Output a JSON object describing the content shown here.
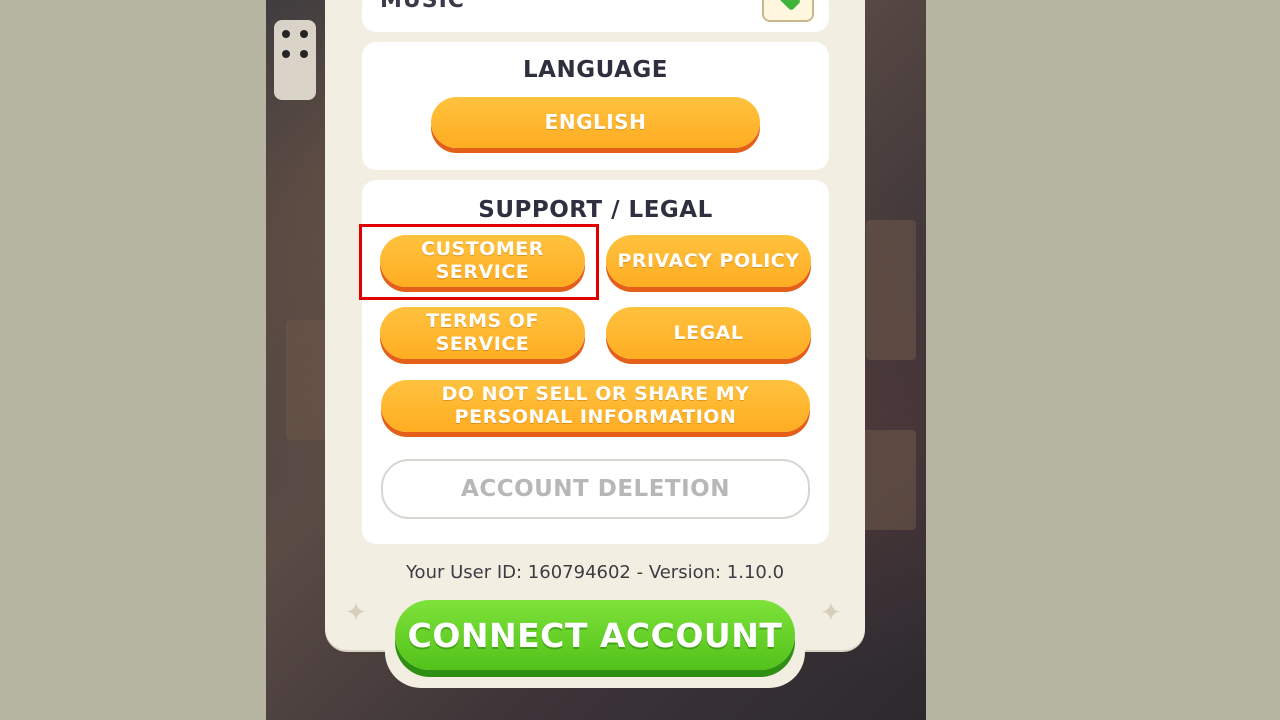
{
  "settings": {
    "music_label": "MUSIC",
    "language": {
      "title": "LANGUAGE",
      "selected": "ENGLISH"
    },
    "support_legal": {
      "title": "SUPPORT / LEGAL",
      "customer_service": "CUSTOMER SERVICE",
      "privacy_policy": "PRIVACY POLICY",
      "terms_of_service": "TERMS OF SERVICE",
      "legal": "LEGAL",
      "do_not_sell": "DO NOT SELL OR SHARE MY PERSONAL INFORMATION",
      "account_deletion": "ACCOUNT DELETION"
    },
    "footer": "Your User ID: 160794602  -  Version: 1.10.0",
    "connect_account": "CONNECT ACCOUNT"
  },
  "colors": {
    "orange_button": "#ffb22a",
    "orange_shadow": "#e35f1a",
    "green_button": "#5ccc22",
    "highlight": "#e10000",
    "page_bg": "#b5b5a2"
  }
}
